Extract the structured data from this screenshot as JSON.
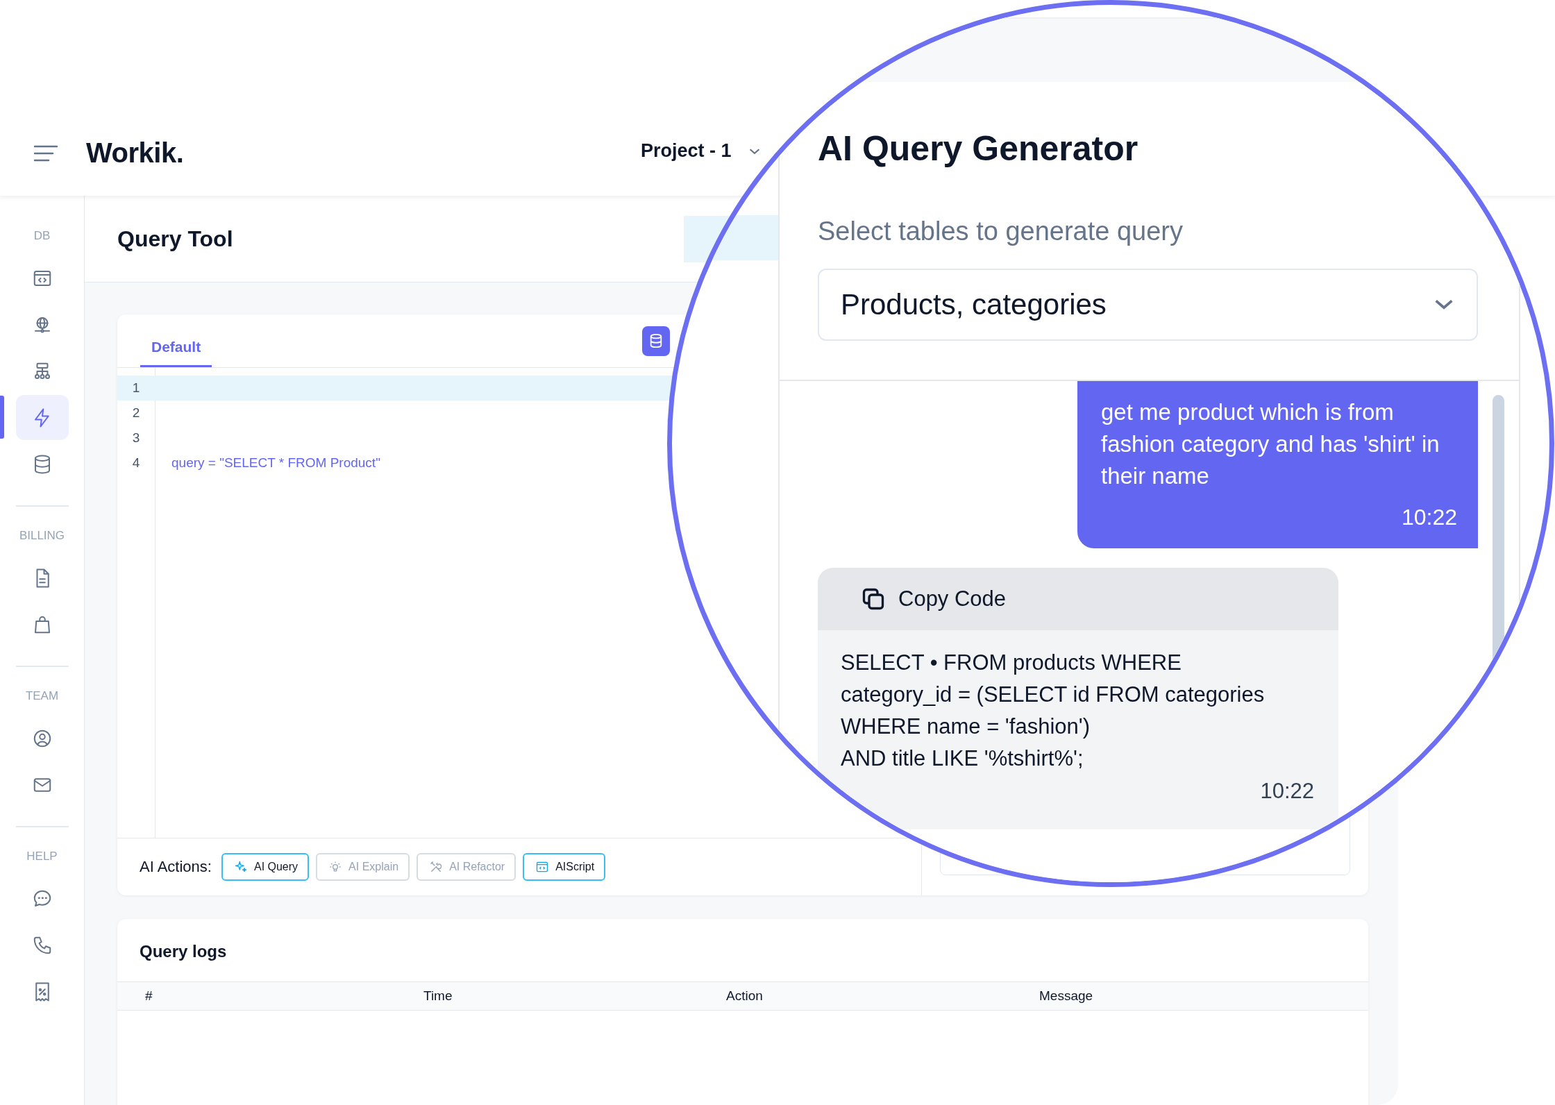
{
  "header": {
    "logo": "Workik.",
    "project": "Project - 1"
  },
  "sidebar": {
    "sections": [
      {
        "label": "DB",
        "items": [
          {
            "selected": false
          },
          {
            "selected": false
          },
          {
            "selected": false
          },
          {
            "selected": true
          },
          {
            "selected": false
          }
        ]
      },
      {
        "label": "BILLING",
        "items": [
          {
            "selected": false
          },
          {
            "selected": false
          }
        ]
      },
      {
        "label": "TEAM",
        "items": [
          {
            "selected": false
          },
          {
            "selected": false
          }
        ]
      },
      {
        "label": "HELP",
        "items": [
          {
            "selected": false
          },
          {
            "selected": false
          },
          {
            "selected": false
          }
        ]
      }
    ]
  },
  "page_title": "Query Tool",
  "editor": {
    "tabs": [
      {
        "label": "Default",
        "selected": true
      }
    ],
    "lines": [
      {
        "number": "1",
        "current": true
      },
      {
        "number": "2",
        "current": false
      },
      {
        "number": "3",
        "current": false
      },
      {
        "number": "4",
        "current": false,
        "code": "query = \"SELECT * FROM Product\""
      }
    ]
  },
  "ai_actions": {
    "label": "AI Actions:",
    "buttons": [
      {
        "label": "AI Query",
        "disabled": false
      },
      {
        "label": "AI Explain",
        "disabled": true
      },
      {
        "label": "AI Refactor",
        "disabled": true
      },
      {
        "label": "AIScript",
        "disabled": false
      }
    ]
  },
  "query_logs": {
    "title": "Query logs",
    "columns": [
      "#",
      "Time",
      "Action",
      "Message"
    ]
  },
  "magnifier": {
    "title": "AI Query Generator",
    "table_select": {
      "label": "Select tables to generate query",
      "value": "Products, categories"
    },
    "messages": [
      {
        "kind": "user",
        "text": "get me product which is from fashion category and has 'shirt' in their name",
        "time": "10:22"
      },
      {
        "kind": "code",
        "copy_label": "Copy Code",
        "lines": [
          "SELECT • FROM products WHERE",
          "category_id = (SELECT id FROM categories",
          "WHERE name = 'fashion')",
          "AND title LIKE '%tshirt%';"
        ],
        "time": "10:22"
      }
    ]
  }
}
